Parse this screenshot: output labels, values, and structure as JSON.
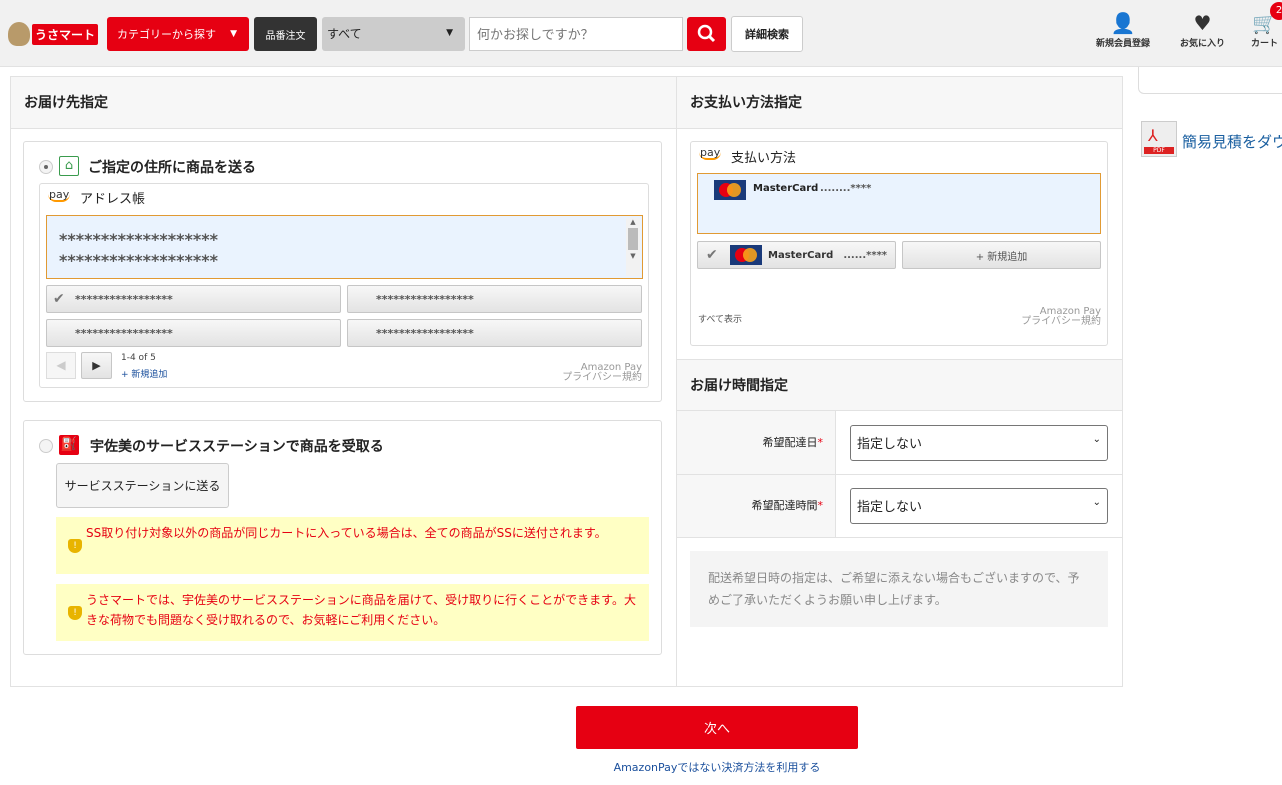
{
  "header": {
    "logo_text": "うさマート",
    "category_button": "カテゴリーから探す",
    "sku_order_button": "品番注文",
    "scope_select": "すべて",
    "search_placeholder": "何かお探しですか？",
    "advanced_search": "詳細検索",
    "register": "新規会員登録",
    "favorites": "お気に入り",
    "cart": "カート",
    "cart_count": "2"
  },
  "sidebar": {
    "quote_link": "簡易見積をダウ",
    "pdf_label": "PDF"
  },
  "delivery": {
    "title": "お届け先指定",
    "option_address": "ご指定の住所に商品を送る",
    "address_book": {
      "pay_logo": "pay",
      "title": "アドレス帳",
      "selected_lines": [
        "*******************",
        "*******************"
      ],
      "addresses": [
        "*****************",
        "*****************",
        "*****************",
        "*****************"
      ],
      "pagination": "1-4 of 5",
      "add_new": "+ 新規追加",
      "amazon_pay": "Amazon Pay",
      "privacy": "プライバシー規約"
    },
    "option_station": "宇佐美のサービスステーションで商品を受取る",
    "station_button": "サービスステーションに送る",
    "notes": [
      "SS取り付け対象以外の商品が同じカートに入っている場合は、全ての商品がSSに送付されます。",
      "うさマートでは、宇佐美のサービスステーションに商品を届けて、受け取りに行くことができます。大きな荷物でも問題なく受け取れるので、お気軽にご利用ください。"
    ]
  },
  "payment": {
    "title": "お支払い方法指定",
    "pay_logo": "pay",
    "widget_title": "支払い方法",
    "selected_card": {
      "brand": "MasterCard",
      "number": "........****"
    },
    "cards": [
      {
        "brand": "MasterCard",
        "number": "......****"
      }
    ],
    "add_new": "+ 新規追加",
    "show_all": "すべて表示",
    "amazon_pay": "Amazon Pay",
    "privacy": "プライバシー規約"
  },
  "delivery_time": {
    "title": "お届け時間指定",
    "date_label": "希望配達日",
    "date_value": "指定しない",
    "time_label": "希望配達時間",
    "time_value": "指定しない",
    "required_mark": "*",
    "note": "配送希望日時の指定は、ご希望に添えない場合もございますので、予めご了承いただくようお願い申し上げます。"
  },
  "footer": {
    "next_button": "次へ",
    "alt_payment_link": "AmazonPayではない決済方法を利用する"
  },
  "colors": {
    "brand_red": "#e60012",
    "selected_border": "#e19a33",
    "selected_bg": "#eaf3fe",
    "note_bg": "#ffffc4"
  }
}
